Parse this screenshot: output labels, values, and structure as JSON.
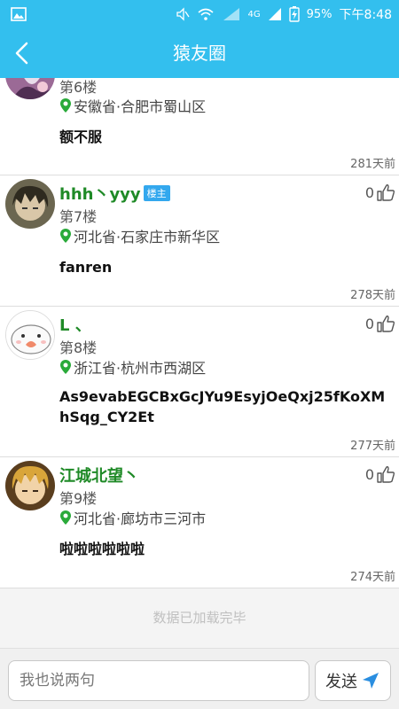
{
  "status_bar": {
    "battery": "95%",
    "time": "下午8:48",
    "network": "4G"
  },
  "header": {
    "title": "猿友圈"
  },
  "posts": [
    {
      "nickname": "",
      "floor": "第6楼",
      "location": "安徽省·合肥市蜀山区",
      "content": "额不服",
      "time": "281天前"
    },
    {
      "nickname": "hhh丶yyy",
      "badge": "楼主",
      "likes": "0",
      "floor": "第7楼",
      "location": "河北省·石家庄市新华区",
      "content": "fanren",
      "time": "278天前"
    },
    {
      "nickname": "L 、",
      "likes": "0",
      "floor": "第8楼",
      "location": "浙江省·杭州市西湖区",
      "content": "As9evabEGCBxGcJYu9EsyjOeQxj25fKoXMhSqg_CY2Et",
      "time": "277天前"
    },
    {
      "nickname": "江城北望丶",
      "likes": "0",
      "floor": "第9楼",
      "location": "河北省·廊坊市三河市",
      "content": "啦啦啦啦啦啦",
      "time": "274天前"
    }
  ],
  "footer_status": "数据已加载完毕",
  "comment_bar": {
    "placeholder": "我也说两句",
    "send_label": "发送"
  },
  "colors": {
    "accent": "#33bfee",
    "nickname": "#1f8a27",
    "location_pin": "#2aaa3a"
  }
}
